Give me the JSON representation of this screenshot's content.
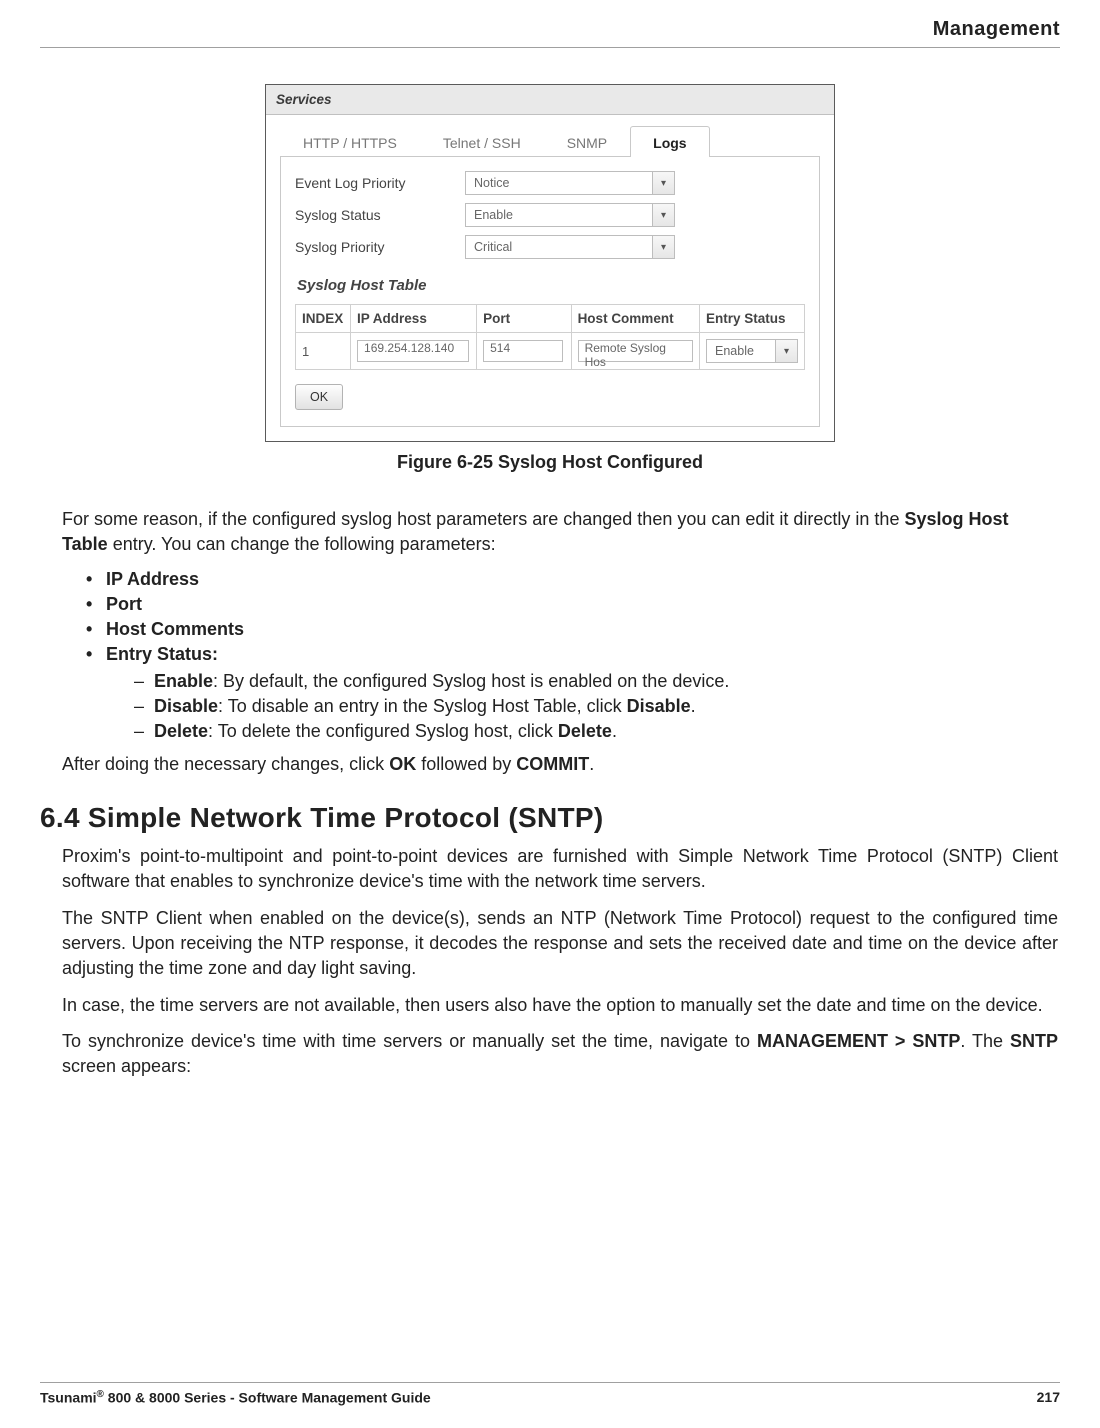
{
  "header": {
    "chapter": "Management"
  },
  "screenshot": {
    "panelTitle": "Services",
    "tabs": [
      "HTTP / HTTPS",
      "Telnet / SSH",
      "SNMP",
      "Logs"
    ],
    "activeTab": "Logs",
    "fields": [
      {
        "label": "Event Log Priority",
        "value": "Notice"
      },
      {
        "label": "Syslog Status",
        "value": "Enable"
      },
      {
        "label": "Syslog Priority",
        "value": "Critical"
      }
    ],
    "subheading": "Syslog Host Table",
    "tableHeaders": [
      "INDEX",
      "IP Address",
      "Port",
      "Host Comment",
      "Entry Status"
    ],
    "row": {
      "index": "1",
      "ip": "169.254.128.140",
      "port": "514",
      "comment": "Remote Syslog Hos",
      "status": "Enable"
    },
    "okLabel": "OK"
  },
  "caption": "Figure 6-25 Syslog Host Configured",
  "body": {
    "intro_a": "For some reason, if the configured syslog host parameters are changed then you can edit it directly in the ",
    "intro_bold": "Syslog Host Table",
    "intro_b": " entry. You can change the following parameters:",
    "bullets": {
      "ip": "IP Address",
      "port": "Port",
      "hostComments": "Host Comments",
      "entryStatus": "Entry Status:"
    },
    "entryStatusItems": {
      "enable_b": "Enable",
      "enable_t": ": By default, the configured Syslog host is enabled on the device.",
      "disable_b": "Disable",
      "disable_t1": ": To disable an entry in the Syslog Host Table, click ",
      "disable_t2": "Disable",
      "disable_t3": ".",
      "delete_b": "Delete",
      "delete_t1": ": To delete the configured Syslog host, click ",
      "delete_t2": "Delete",
      "delete_t3": "."
    },
    "after_a": "After doing the necessary changes, click ",
    "after_b1": "OK",
    "after_mid": " followed by ",
    "after_b2": "COMMIT",
    "after_end": "."
  },
  "section": {
    "heading": "6.4 Simple Network Time Protocol (SNTP)",
    "p1": "Proxim's point-to-multipoint and point-to-point devices are furnished with Simple Network Time Protocol (SNTP) Client software that enables to synchronize device's time with the network time servers.",
    "p2": "The SNTP Client when enabled on the device(s), sends an NTP (Network Time Protocol) request to the configured time servers. Upon receiving the NTP response, it decodes the response and sets the received date and time on the device after adjusting the time zone and day light saving.",
    "p3": "In case, the time servers are not available, then users also have the option to manually set the date and time on the device.",
    "p4_a": "To synchronize device's time with time servers or manually set the time, navigate to ",
    "p4_b": "MANAGEMENT > SNTP",
    "p4_c": ". The ",
    "p4_d": "SNTP",
    "p4_e": " screen appears:"
  },
  "footer": {
    "left_a": "Tsunami",
    "left_b": " 800 & 8000 Series - Software Management Guide",
    "pageNum": "217"
  }
}
